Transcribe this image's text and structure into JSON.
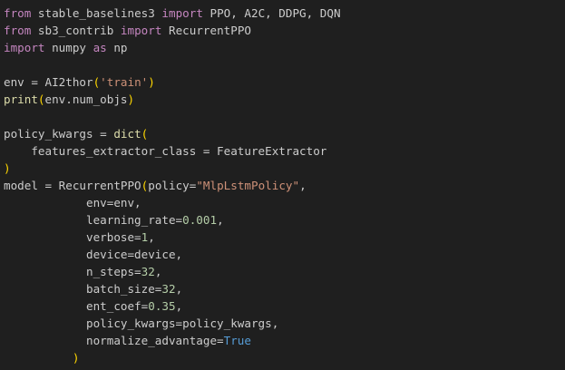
{
  "code": {
    "language": "python",
    "lines": [
      [
        {
          "t": "from",
          "c": "kw"
        },
        {
          "t": " stable_baselines3 ",
          "c": "plain"
        },
        {
          "t": "import",
          "c": "kw"
        },
        {
          "t": " PPO, A2C, DDPG, DQN",
          "c": "plain"
        }
      ],
      [
        {
          "t": "from",
          "c": "kw"
        },
        {
          "t": " sb3_contrib ",
          "c": "plain"
        },
        {
          "t": "import",
          "c": "kw"
        },
        {
          "t": " RecurrentPPO",
          "c": "plain"
        }
      ],
      [
        {
          "t": "import",
          "c": "kw"
        },
        {
          "t": " numpy ",
          "c": "plain"
        },
        {
          "t": "as",
          "c": "kw"
        },
        {
          "t": " np",
          "c": "plain"
        }
      ],
      [],
      [
        {
          "t": "env = AI2thor",
          "c": "plain"
        },
        {
          "t": "(",
          "c": "paren"
        },
        {
          "t": "'train'",
          "c": "str"
        },
        {
          "t": ")",
          "c": "paren"
        }
      ],
      [
        {
          "t": "print",
          "c": "fn"
        },
        {
          "t": "(",
          "c": "paren"
        },
        {
          "t": "env.num_objs",
          "c": "plain"
        },
        {
          "t": ")",
          "c": "paren"
        }
      ],
      [],
      [
        {
          "t": "policy_kwargs = ",
          "c": "plain"
        },
        {
          "t": "dict",
          "c": "fn"
        },
        {
          "t": "(",
          "c": "paren"
        }
      ],
      [
        {
          "t": "    features_extractor_class = FeatureExtractor",
          "c": "plain"
        }
      ],
      [
        {
          "t": ")",
          "c": "paren"
        }
      ],
      [
        {
          "t": "model = RecurrentPPO",
          "c": "plain"
        },
        {
          "t": "(",
          "c": "paren"
        },
        {
          "t": "policy=",
          "c": "plain"
        },
        {
          "t": "\"MlpLstmPolicy\"",
          "c": "str"
        },
        {
          "t": ",",
          "c": "plain"
        }
      ],
      [
        {
          "t": "            env=env,",
          "c": "plain"
        }
      ],
      [
        {
          "t": "            learning_rate=",
          "c": "plain"
        },
        {
          "t": "0.001",
          "c": "num"
        },
        {
          "t": ",",
          "c": "plain"
        }
      ],
      [
        {
          "t": "            verbose=",
          "c": "plain"
        },
        {
          "t": "1",
          "c": "num"
        },
        {
          "t": ",",
          "c": "plain"
        }
      ],
      [
        {
          "t": "            device=device,",
          "c": "plain"
        }
      ],
      [
        {
          "t": "            n_steps=",
          "c": "plain"
        },
        {
          "t": "32",
          "c": "num"
        },
        {
          "t": ",",
          "c": "plain"
        }
      ],
      [
        {
          "t": "            batch_size=",
          "c": "plain"
        },
        {
          "t": "32",
          "c": "num"
        },
        {
          "t": ",",
          "c": "plain"
        }
      ],
      [
        {
          "t": "            ent_coef=",
          "c": "plain"
        },
        {
          "t": "0.35",
          "c": "num"
        },
        {
          "t": ",",
          "c": "plain"
        }
      ],
      [
        {
          "t": "            policy_kwargs=policy_kwargs,",
          "c": "plain"
        }
      ],
      [
        {
          "t": "            normalize_advantage=",
          "c": "plain"
        },
        {
          "t": "True",
          "c": "const"
        }
      ],
      [
        {
          "t": "          ",
          "c": "ws"
        },
        {
          "t": ")",
          "c": "paren"
        }
      ]
    ]
  },
  "colors": {
    "background": "#1f1f1f",
    "keyword": "#c586c0",
    "function": "#dcdcaa",
    "string": "#ce9178",
    "number": "#b5cea8",
    "constant": "#569cd6",
    "bracket": "#ffd700",
    "text": "#cccccc"
  }
}
